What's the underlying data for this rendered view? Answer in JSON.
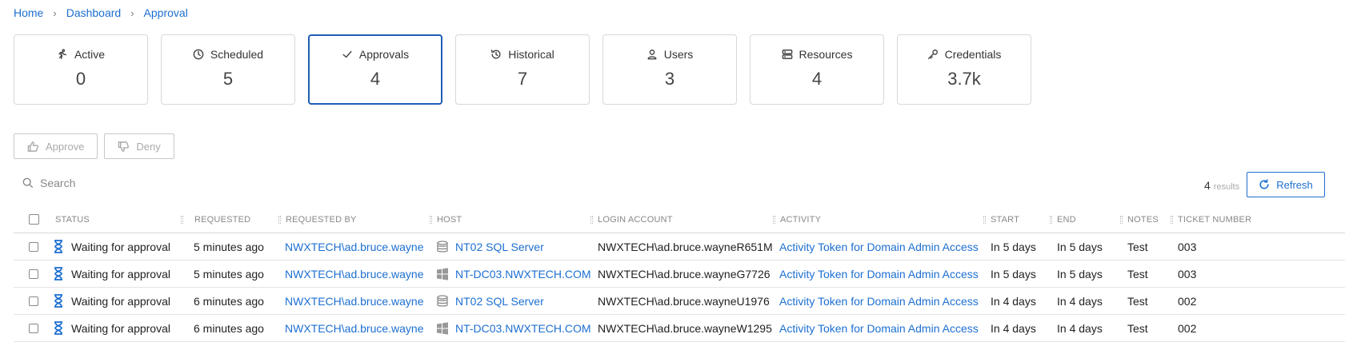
{
  "breadcrumb": [
    "Home",
    "Dashboard",
    "Approval"
  ],
  "cards": [
    {
      "label": "Active",
      "value": "0",
      "icon": "running-icon"
    },
    {
      "label": "Scheduled",
      "value": "5",
      "icon": "clock-icon"
    },
    {
      "label": "Approvals",
      "value": "4",
      "icon": "check-icon",
      "selected": true
    },
    {
      "label": "Historical",
      "value": "7",
      "icon": "history-icon"
    },
    {
      "label": "Users",
      "value": "3",
      "icon": "user-icon"
    },
    {
      "label": "Resources",
      "value": "4",
      "icon": "server-icon"
    },
    {
      "label": "Credentials",
      "value": "3.7k",
      "icon": "key-icon"
    }
  ],
  "actions": {
    "approve": "Approve",
    "deny": "Deny"
  },
  "search": {
    "placeholder": "Search",
    "value": ""
  },
  "results": {
    "count": "4",
    "label": "results"
  },
  "refresh_label": "Refresh",
  "table": {
    "columns": [
      "STATUS",
      "REQUESTED",
      "REQUESTED BY",
      "HOST",
      "LOGIN ACCOUNT",
      "ACTIVITY",
      "START",
      "END",
      "NOTES",
      "TICKET NUMBER"
    ],
    "rows": [
      {
        "status": "Waiting for approval",
        "requested": "5 minutes ago",
        "requested_by": "NWXTECH\\ad.bruce.wayne",
        "host": "NT02 SQL Server",
        "host_icon": "database-icon",
        "login": "NWXTECH\\ad.bruce.wayneR651M",
        "activity": "Activity Token for Domain Admin Access",
        "start": "In 5 days",
        "end": "In 5 days",
        "notes": "Test",
        "ticket": "003"
      },
      {
        "status": "Waiting for approval",
        "requested": "5 minutes ago",
        "requested_by": "NWXTECH\\ad.bruce.wayne",
        "host": "NT-DC03.NWXTECH.COM",
        "host_icon": "windows-icon",
        "login": "NWXTECH\\ad.bruce.wayneG7726",
        "activity": "Activity Token for Domain Admin Access",
        "start": "In 5 days",
        "end": "In 5 days",
        "notes": "Test",
        "ticket": "003"
      },
      {
        "status": "Waiting for approval",
        "requested": "6 minutes ago",
        "requested_by": "NWXTECH\\ad.bruce.wayne",
        "host": "NT02 SQL Server",
        "host_icon": "database-icon",
        "login": "NWXTECH\\ad.bruce.wayneU1976",
        "activity": "Activity Token for Domain Admin Access",
        "start": "In 4 days",
        "end": "In 4 days",
        "notes": "Test",
        "ticket": "002"
      },
      {
        "status": "Waiting for approval",
        "requested": "6 minutes ago",
        "requested_by": "NWXTECH\\ad.bruce.wayne",
        "host": "NT-DC03.NWXTECH.COM",
        "host_icon": "windows-icon",
        "login": "NWXTECH\\ad.bruce.wayneW1295",
        "activity": "Activity Token for Domain Admin Access",
        "start": "In 4 days",
        "end": "In 4 days",
        "notes": "Test",
        "ticket": "002"
      }
    ]
  }
}
